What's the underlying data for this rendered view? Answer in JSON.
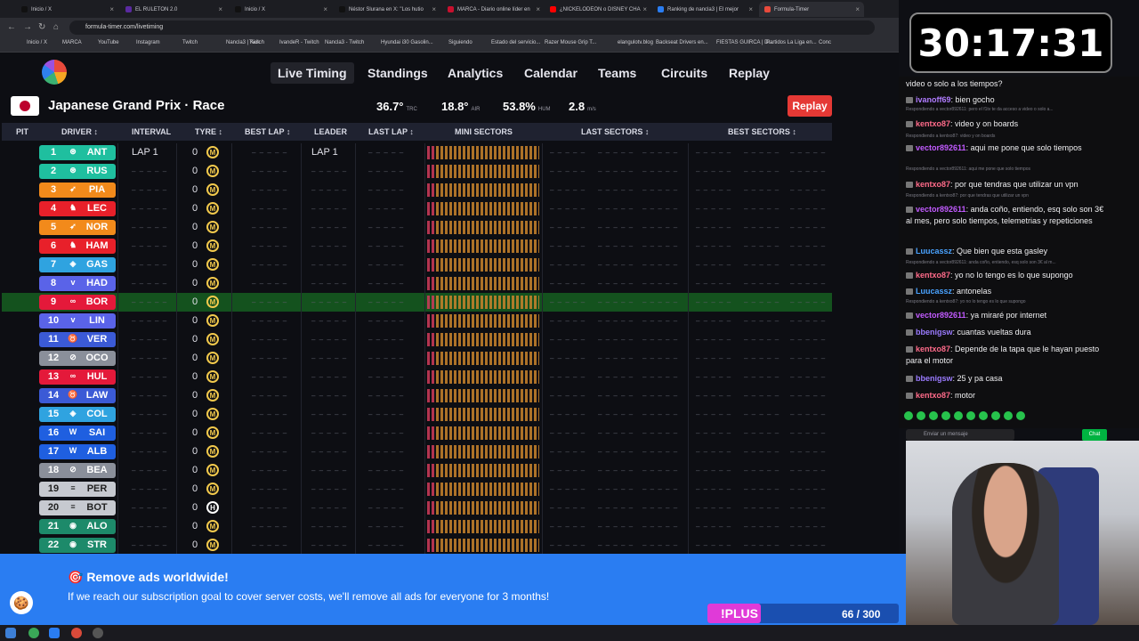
{
  "browser": {
    "tabs": [
      {
        "label": "Inicio / X",
        "color": "#111111"
      },
      {
        "label": "EL RULETON 2.0",
        "color": "#5a2aa0"
      },
      {
        "label": "Inicio / X",
        "color": "#111111"
      },
      {
        "label": "Néstor Slurana en X: \"Los hutio",
        "color": "#111111"
      },
      {
        "label": "MARCA - Diario online líder en",
        "color": "#c8102e"
      },
      {
        "label": "¿NICKELODEON o DISNEY CHA",
        "color": "#ff0000"
      },
      {
        "label": "Ranking de nancla3 | El mejor",
        "color": "#2a7df2"
      },
      {
        "label": "Formula-Timer",
        "color": "#e84a3c"
      }
    ],
    "url": "formula-timer.com/livetiming",
    "bookmarks": [
      "Inicio / X",
      "MARCA",
      "YouTube",
      "Instagram",
      "Twitch",
      "Nancla3 | Kick",
      "Twitch",
      "IvandeR - Twitch",
      "Nancla3 - Twitch",
      "Hyundai i30 Gasolin...",
      "Siguiendo",
      "Estado del servicio...",
      "Razer Mouse Grip T...",
      "elangulotv.blog",
      "Backseat Drivers en...",
      "FIESTAS GUIRCA | Di...",
      "Partidos La Liga en...",
      "Conc"
    ]
  },
  "nav": {
    "links": [
      "Live Timing",
      "Standings",
      "Analytics",
      "Calendar",
      "Teams",
      "Circuits",
      "Replay"
    ]
  },
  "session": {
    "title": "Japanese Grand Prix · Race",
    "weather": [
      {
        "value": "36.7°",
        "label": "TRC"
      },
      {
        "value": "18.8°",
        "label": "AIR"
      },
      {
        "value": "53.8%",
        "label": "HUM"
      },
      {
        "value": "2.8",
        "label": "m/s"
      }
    ],
    "replay_label": "Replay"
  },
  "table": {
    "headers": [
      "PIT",
      "DRIVER ↕",
      "INTERVAL",
      "TYRE ↕",
      "BEST LAP ↕",
      "LEADER",
      "LAST LAP ↕",
      "MINI SECTORS",
      "LAST SECTORS ↕",
      "BEST SECTORS ↕"
    ],
    "placeholder": "– – – – –",
    "rows": [
      {
        "pos": "1",
        "code": "ANT",
        "team": "⊛",
        "color": "#1fbf9f",
        "interval": "LAP 1",
        "leader": "LAP 1",
        "laps": "0",
        "tyre": "M"
      },
      {
        "pos": "2",
        "code": "RUS",
        "team": "⊛",
        "color": "#1fbf9f",
        "interval": "",
        "leader": "",
        "laps": "0",
        "tyre": "M"
      },
      {
        "pos": "3",
        "code": "PIA",
        "team": "➶",
        "color": "#f28a1b",
        "interval": "",
        "leader": "",
        "laps": "0",
        "tyre": "M"
      },
      {
        "pos": "4",
        "code": "LEC",
        "team": "♞",
        "color": "#e8202a",
        "interval": "",
        "leader": "",
        "laps": "0",
        "tyre": "M"
      },
      {
        "pos": "5",
        "code": "NOR",
        "team": "➶",
        "color": "#f28a1b",
        "interval": "",
        "leader": "",
        "laps": "0",
        "tyre": "M"
      },
      {
        "pos": "6",
        "code": "HAM",
        "team": "♞",
        "color": "#e8202a",
        "interval": "",
        "leader": "",
        "laps": "0",
        "tyre": "M"
      },
      {
        "pos": "7",
        "code": "GAS",
        "team": "◈",
        "color": "#2fa3e0",
        "interval": "",
        "leader": "",
        "laps": "0",
        "tyre": "M"
      },
      {
        "pos": "8",
        "code": "HAD",
        "team": "ᴠ",
        "color": "#5a63e8",
        "interval": "",
        "leader": "",
        "laps": "0",
        "tyre": "M"
      },
      {
        "pos": "9",
        "code": "BOR",
        "team": "∞",
        "color": "#e4193a",
        "interval": "",
        "leader": "",
        "laps": "0",
        "tyre": "M",
        "selected": true
      },
      {
        "pos": "10",
        "code": "LIN",
        "team": "ᴠ",
        "color": "#5a63e8",
        "interval": "",
        "leader": "",
        "laps": "0",
        "tyre": "M"
      },
      {
        "pos": "11",
        "code": "VER",
        "team": "♉",
        "color": "#3b5ad6",
        "interval": "",
        "leader": "",
        "laps": "0",
        "tyre": "M"
      },
      {
        "pos": "12",
        "code": "OCO",
        "team": "⊘",
        "color": "#8a8f9a",
        "interval": "",
        "leader": "",
        "laps": "0",
        "tyre": "M"
      },
      {
        "pos": "13",
        "code": "HUL",
        "team": "∞",
        "color": "#e4193a",
        "interval": "",
        "leader": "",
        "laps": "0",
        "tyre": "M"
      },
      {
        "pos": "14",
        "code": "LAW",
        "team": "♉",
        "color": "#3b5ad6",
        "interval": "",
        "leader": "",
        "laps": "0",
        "tyre": "M"
      },
      {
        "pos": "15",
        "code": "COL",
        "team": "◈",
        "color": "#2fa3e0",
        "interval": "",
        "leader": "",
        "laps": "0",
        "tyre": "M"
      },
      {
        "pos": "16",
        "code": "SAI",
        "team": "W",
        "color": "#1f5fe0",
        "interval": "",
        "leader": "",
        "laps": "0",
        "tyre": "M"
      },
      {
        "pos": "17",
        "code": "ALB",
        "team": "W",
        "color": "#1f5fe0",
        "interval": "",
        "leader": "",
        "laps": "0",
        "tyre": "M"
      },
      {
        "pos": "18",
        "code": "BEA",
        "team": "⊘",
        "color": "#8a8f9a",
        "interval": "",
        "leader": "",
        "laps": "0",
        "tyre": "M"
      },
      {
        "pos": "19",
        "code": "PER",
        "team": "≡",
        "color": "#c6c9d0",
        "interval": "",
        "leader": "",
        "laps": "0",
        "tyre": "M"
      },
      {
        "pos": "20",
        "code": "BOT",
        "team": "≡",
        "color": "#c6c9d0",
        "interval": "",
        "leader": "",
        "laps": "0",
        "tyre": "H"
      },
      {
        "pos": "21",
        "code": "ALO",
        "team": "◉",
        "color": "#1d8a6a",
        "interval": "",
        "leader": "",
        "laps": "0",
        "tyre": "M"
      },
      {
        "pos": "22",
        "code": "STR",
        "team": "◉",
        "color": "#1d8a6a",
        "interval": "",
        "leader": "",
        "laps": "0",
        "tyre": "M"
      }
    ]
  },
  "banner": {
    "title": "🎯 Remove ads worldwide!",
    "subtitle": "If we reach our subscription goal to cover server costs, we'll remove all ads for everyone for 3 months!",
    "plus_label": "!PLUS",
    "goal_text": "66 / 300",
    "progress": 0.22
  },
  "stream": {
    "timer": "30:17:31",
    "chat": [
      {
        "text": "video o solo a los tiempos?"
      },
      {
        "user": "ivanoff69",
        "color": "#b07cff",
        "text": "bien gocho"
      },
      {
        "reply": "Respondiendo a vector892611: pero el f1tv te da acceso a video o solo a..."
      },
      {
        "user": "kentxo87",
        "color": "#ff6b8a",
        "text": "video y on boards"
      },
      {
        "reply": "Respondiendo a kentxo87: video y on boards"
      },
      {
        "user": "vector892611",
        "color": "#c25bff",
        "text": "aqui me pone que solo tiempos"
      },
      {
        "reply": "Respondiendo a vector892611: aqui me pone que solo tiempos"
      },
      {
        "user": "kentxo87",
        "color": "#ff6b8a",
        "text": "por que tendras que utilizar un vpn"
      },
      {
        "reply": "Respondiendo a kentxo87: por que tendras que utilizar un vpn"
      },
      {
        "user": "vector892611",
        "color": "#c25bff",
        "text": "anda coño, entiendo, esq solo son 3€ al mes, pero solo tiempos, telemetrias y repeticiones"
      },
      {
        "user": "Luucassz",
        "color": "#4aa3ff",
        "text": "Que bien que esta gasley"
      },
      {
        "reply": "Respondiendo a vector892611: anda coño, entiendo, esq solo son 3€ al m..."
      },
      {
        "user": "kentxo87",
        "color": "#ff6b8a",
        "text": "yo no lo tengo es lo que supongo"
      },
      {
        "user": "Luucassz",
        "color": "#4aa3ff",
        "text": "antonelas"
      },
      {
        "reply": "Respondiendo a kentxo87: yo no lo tengo es lo que supongo"
      },
      {
        "user": "vector892611",
        "color": "#c25bff",
        "text": "ya miraré por internet"
      },
      {
        "user": "bbenigsw",
        "color": "#9b7bff",
        "text": "cuantas vueltas dura"
      },
      {
        "user": "kentxo87",
        "color": "#ff6b8a",
        "text": "Depende de la tapa que le hayan puesto para el motor"
      },
      {
        "user": "bbenigsw",
        "color": "#9b7bff",
        "text": "25 y pa casa"
      },
      {
        "user": "kentxo87",
        "color": "#ff6b8a",
        "text": "motor"
      }
    ],
    "input_placeholder": "Enviar un mensaje",
    "chat_button": "Chat"
  }
}
